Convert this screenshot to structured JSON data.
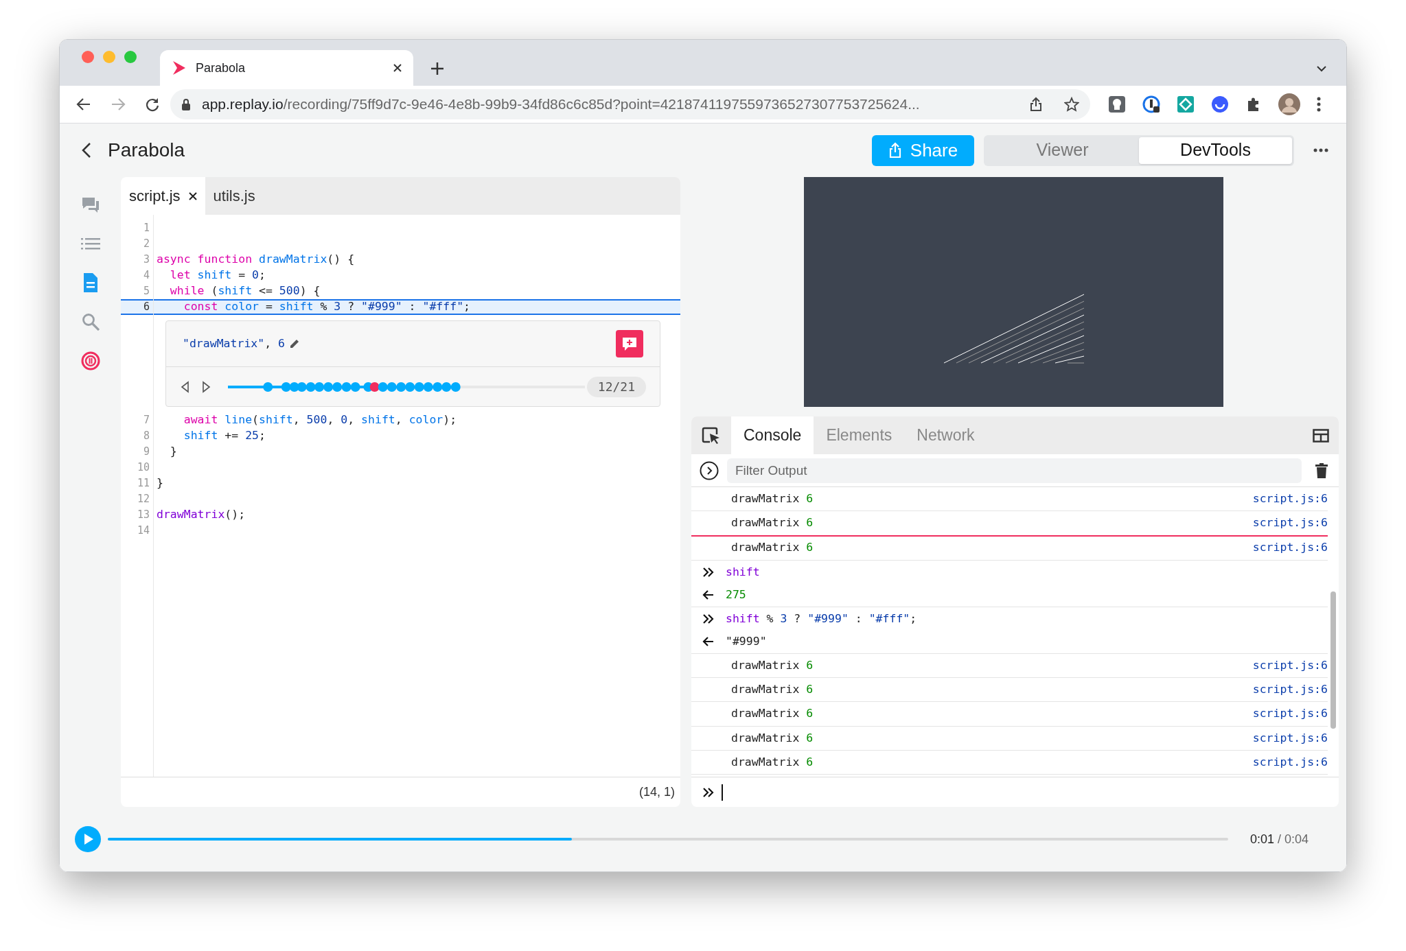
{
  "browser": {
    "tab": {
      "title": "Parabola"
    },
    "address": {
      "host": "app.replay.io",
      "path": "/recording/75ff9d7c-9e46-4e8b-99b9-34fd86c6c85d?point=4218741197559736527307753725624..."
    }
  },
  "header": {
    "title": "Parabola",
    "share_button": "Share",
    "modes": [
      {
        "label": "Viewer",
        "selected": false
      },
      {
        "label": "DevTools",
        "selected": true
      }
    ]
  },
  "sidebar": {
    "items": [
      {
        "kind": "comments",
        "selected": false
      },
      {
        "kind": "outline",
        "selected": false
      },
      {
        "kind": "sources",
        "selected": true
      },
      {
        "kind": "search",
        "selected": false
      },
      {
        "kind": "replay",
        "selected": false
      }
    ]
  },
  "editor": {
    "tabs": [
      {
        "label": "script.js",
        "selected": true
      },
      {
        "label": "utils.js",
        "selected": false
      }
    ],
    "blocks": [
      {
        "kind": "line",
        "number": "1",
        "current": false
      },
      {
        "kind": "line",
        "number": "2",
        "current": false
      },
      {
        "kind": "line",
        "number": "3",
        "current": false,
        "tokens": [
          {
            "text": "async function ",
            "kind": "kw"
          },
          {
            "text": "drawMatrix",
            "kind": "name"
          },
          {
            "text": "() {",
            "kind": "plain"
          }
        ]
      },
      {
        "kind": "line",
        "number": "4",
        "current": false,
        "tokens": [
          {
            "text": "  let ",
            "kind": "kw"
          },
          {
            "text": "shift",
            "kind": "name"
          },
          {
            "text": " = ",
            "kind": "plain"
          },
          {
            "text": "0",
            "kind": "num"
          },
          {
            "text": ";",
            "kind": "plain"
          }
        ]
      },
      {
        "kind": "line",
        "number": "5",
        "current": false,
        "tokens": [
          {
            "text": "  while",
            "kind": "kw"
          },
          {
            "text": " (",
            "kind": "plain"
          },
          {
            "text": "shift",
            "kind": "name"
          },
          {
            "text": " <= ",
            "kind": "plain"
          },
          {
            "text": "500",
            "kind": "num"
          },
          {
            "text": ") {",
            "kind": "plain"
          }
        ]
      },
      {
        "kind": "line",
        "number": "6",
        "current": true,
        "tokens": [
          {
            "text": "    const ",
            "kind": "kw"
          },
          {
            "text": "color",
            "kind": "name"
          },
          {
            "text": " = ",
            "kind": "plain"
          },
          {
            "text": "shift",
            "kind": "name"
          },
          {
            "text": " % ",
            "kind": "plain"
          },
          {
            "text": "3",
            "kind": "num"
          },
          {
            "text": " ? ",
            "kind": "plain"
          },
          {
            "text": "\"#999\"",
            "kind": "str"
          },
          {
            "text": " : ",
            "kind": "plain"
          },
          {
            "text": "\"#fff\"",
            "kind": "str"
          },
          {
            "text": ";",
            "kind": "plain"
          }
        ]
      },
      {
        "kind": "logpoint",
        "tokens": [
          {
            "text": "\"drawMatrix\"",
            "kind": "str"
          },
          {
            "text": ", ",
            "kind": "plain"
          },
          {
            "text": "6",
            "kind": "num"
          }
        ],
        "level": 0.64,
        "counter": "12/21"
      },
      {
        "kind": "line",
        "number": "7",
        "current": false,
        "tokens": [
          {
            "text": "    await ",
            "kind": "kw"
          },
          {
            "text": "line",
            "kind": "name"
          },
          {
            "text": "(",
            "kind": "plain"
          },
          {
            "text": "shift",
            "kind": "name"
          },
          {
            "text": ", ",
            "kind": "plain"
          },
          {
            "text": "500",
            "kind": "num"
          },
          {
            "text": ", ",
            "kind": "plain"
          },
          {
            "text": "0",
            "kind": "num"
          },
          {
            "text": ", ",
            "kind": "plain"
          },
          {
            "text": "shift",
            "kind": "name"
          },
          {
            "text": ", ",
            "kind": "plain"
          },
          {
            "text": "color",
            "kind": "name"
          },
          {
            "text": ");",
            "kind": "plain"
          }
        ]
      },
      {
        "kind": "line",
        "number": "8",
        "current": false,
        "tokens": [
          {
            "text": "    shift",
            "kind": "name"
          },
          {
            "text": " += ",
            "kind": "plain"
          },
          {
            "text": "25",
            "kind": "num"
          },
          {
            "text": ";",
            "kind": "plain"
          }
        ]
      },
      {
        "kind": "line",
        "number": "9",
        "current": false,
        "tokens": [
          {
            "text": "  }",
            "kind": "plain"
          }
        ]
      },
      {
        "kind": "line",
        "number": "10",
        "current": false
      },
      {
        "kind": "line",
        "number": "11",
        "current": false,
        "tokens": [
          {
            "text": "}",
            "kind": "plain"
          }
        ]
      },
      {
        "kind": "line",
        "number": "12",
        "current": false
      },
      {
        "kind": "line",
        "number": "13",
        "current": false,
        "tokens": [
          {
            "text": "drawMatrix",
            "kind": "call"
          },
          {
            "text": "();",
            "kind": "plain"
          }
        ]
      },
      {
        "kind": "line",
        "number": "14",
        "current": false
      }
    ],
    "cursor": "(14, 1)"
  },
  "devtools": {
    "tabs": [
      {
        "label": "Console",
        "selected": true
      },
      {
        "label": "Elements",
        "selected": false
      },
      {
        "label": "Network",
        "selected": false
      }
    ],
    "filter": {
      "placeholder": "Filter Output"
    },
    "entries": [
      {
        "kind": "log",
        "text": "drawMatrix",
        "value": "6",
        "source": "script.js:6"
      },
      {
        "kind": "log",
        "text": "drawMatrix",
        "value": "6",
        "source": "script.js:6"
      },
      {
        "kind": "pause-line"
      },
      {
        "kind": "log",
        "text": "drawMatrix",
        "value": "6",
        "source": "script.js:6"
      },
      {
        "kind": "input",
        "tokens": [
          {
            "text": "shift",
            "kind": "var"
          }
        ]
      },
      {
        "kind": "output",
        "tokens": [
          {
            "text": "275",
            "kind": "result-num"
          }
        ]
      },
      {
        "kind": "input",
        "tokens": [
          {
            "text": "shift",
            "kind": "var"
          },
          {
            "text": " % ",
            "kind": "plain"
          },
          {
            "text": "3",
            "kind": "num"
          },
          {
            "text": " ? ",
            "kind": "plain"
          },
          {
            "text": "\"#999\"",
            "kind": "str"
          },
          {
            "text": " : ",
            "kind": "plain"
          },
          {
            "text": "\"#fff\"",
            "kind": "str"
          },
          {
            "text": ";",
            "kind": "plain"
          }
        ]
      },
      {
        "kind": "output",
        "tokens": [
          {
            "text": "\"#999\"",
            "kind": "result-str"
          }
        ]
      },
      {
        "kind": "log",
        "text": "drawMatrix",
        "value": "6",
        "source": "script.js:6"
      },
      {
        "kind": "log",
        "text": "drawMatrix",
        "value": "6",
        "source": "script.js:6"
      },
      {
        "kind": "log",
        "text": "drawMatrix",
        "value": "6",
        "source": "script.js:6"
      },
      {
        "kind": "log",
        "text": "drawMatrix",
        "value": "6",
        "source": "script.js:6"
      },
      {
        "kind": "log",
        "text": "drawMatrix",
        "value": "6",
        "source": "script.js:6"
      }
    ]
  },
  "timeline": {
    "level": 0.414,
    "current_time": "0:01",
    "total_time": "/ 0:04"
  }
}
